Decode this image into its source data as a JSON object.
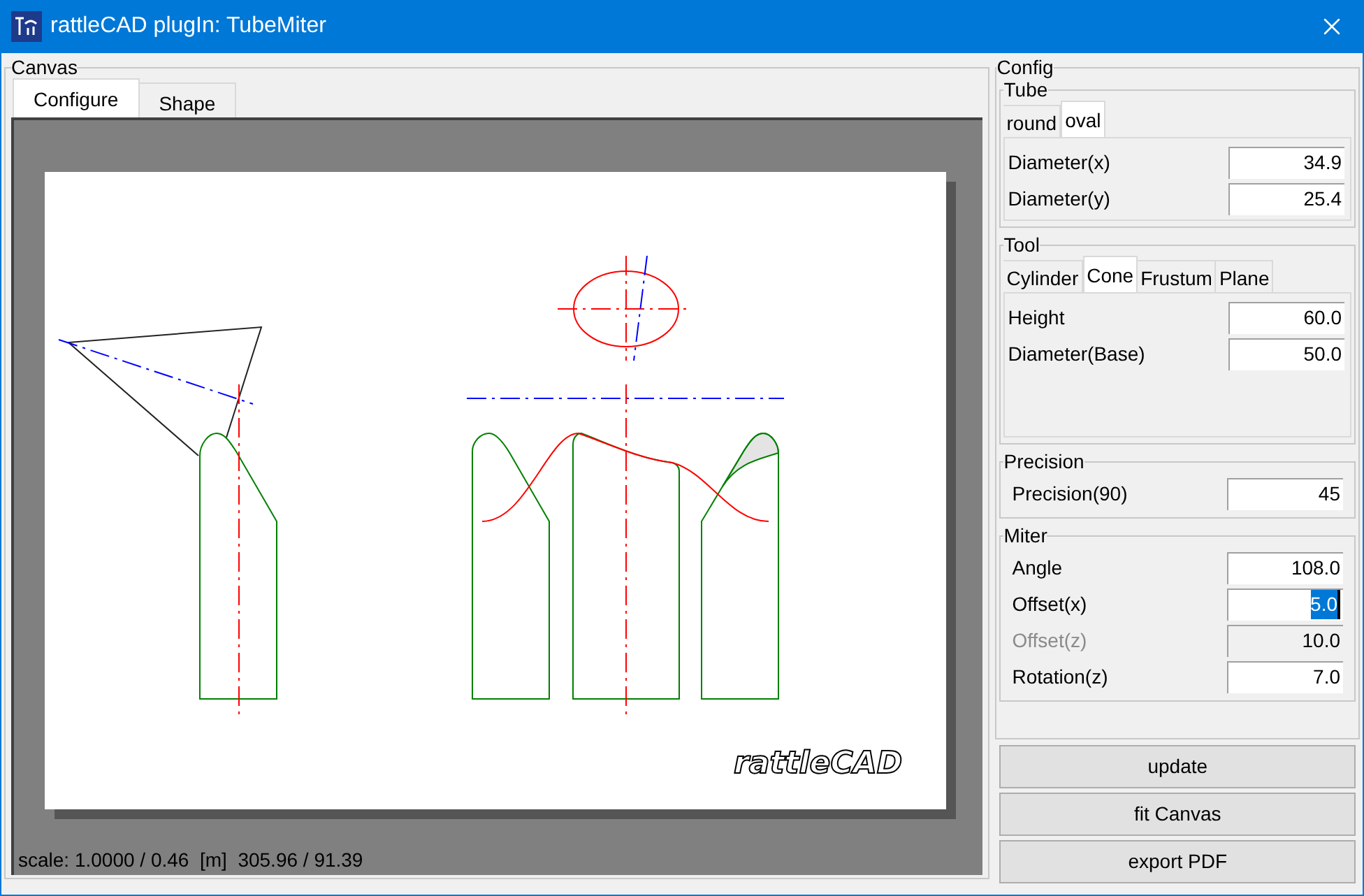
{
  "window": {
    "title": "rattleCAD plugIn: TubeMiter"
  },
  "canvas": {
    "title": "Canvas",
    "tabs": [
      {
        "label": "Configure",
        "selected": true
      },
      {
        "label": "Shape",
        "selected": false
      }
    ],
    "logo": "rattleCAD",
    "status": "scale: 1.0000 / 0.46  [m]  305.96 / 91.39"
  },
  "config": {
    "title": "Config",
    "sections": [
      {
        "title": "Tube",
        "tabs": [
          {
            "label": "round",
            "selected": false
          },
          {
            "label": "oval",
            "selected": true
          }
        ],
        "fields": [
          {
            "label": "Diameter(x)",
            "value": "34.9",
            "disabled": false,
            "text_selected": false
          },
          {
            "label": "Diameter(y)",
            "value": "25.4",
            "disabled": false,
            "text_selected": false
          }
        ]
      },
      {
        "title": "Tool",
        "tabs": [
          {
            "label": "Cylinder",
            "selected": false
          },
          {
            "label": "Cone",
            "selected": true
          },
          {
            "label": "Frustum",
            "selected": false
          },
          {
            "label": "Plane",
            "selected": false
          }
        ],
        "fields": [
          {
            "label": "Height",
            "value": "60.0",
            "disabled": false,
            "text_selected": false
          },
          {
            "label": "Diameter(Base)",
            "value": "50.0",
            "disabled": false,
            "text_selected": false
          }
        ]
      },
      {
        "title": "Precision",
        "fields": [
          {
            "label": "Precision(90)",
            "value": "45",
            "disabled": false,
            "text_selected": false
          }
        ]
      },
      {
        "title": "Miter",
        "fields": [
          {
            "label": "Angle",
            "value": "108.0",
            "disabled": false,
            "text_selected": false
          },
          {
            "label": "Offset(x)",
            "value": "5.0",
            "disabled": false,
            "text_selected": true
          },
          {
            "label": "Offset(z)",
            "value": "10.0",
            "disabled": true,
            "text_selected": false
          },
          {
            "label": "Rotation(z)",
            "value": "7.0",
            "disabled": false,
            "text_selected": false
          }
        ]
      }
    ]
  },
  "buttons": [
    "update",
    "fit Canvas",
    "export PDF"
  ]
}
